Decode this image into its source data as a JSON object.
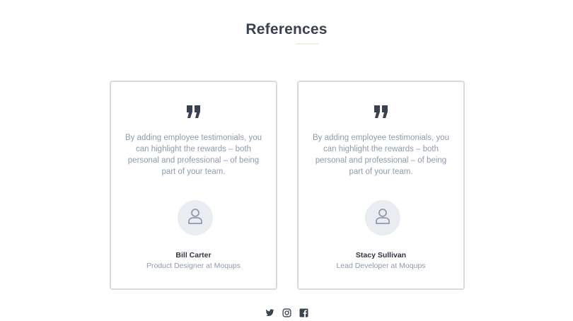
{
  "section": {
    "title": "References"
  },
  "testimonials": [
    {
      "quote": "By adding employee testimonials, you can highlight the rewards – both personal and professional – of being part of your team.",
      "name": "Bill Carter",
      "role": "Product Designer at Moqups"
    },
    {
      "quote": "By adding employee testimonials, you can highlight the rewards – both personal and professional – of being part of your team.",
      "name": "Stacy Sullivan",
      "role": "Lead Developer at Moqups"
    }
  ],
  "social": [
    {
      "icon": "twitter-icon"
    },
    {
      "icon": "instagram-icon"
    },
    {
      "icon": "facebook-icon"
    }
  ],
  "colors": {
    "heading": "#3a4150",
    "body_text": "#8e9aaf",
    "card_border": "#d5dbe3",
    "avatar_bg": "#e9edf2",
    "icon": "#3a4150"
  }
}
